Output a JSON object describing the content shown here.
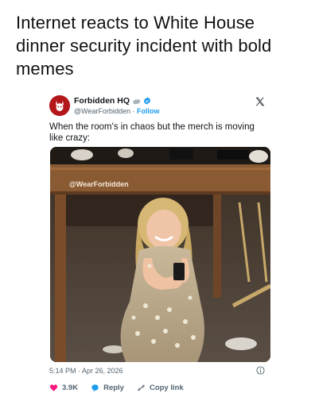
{
  "headline": "Internet reacts to White House dinner security incident with bold memes",
  "tweet": {
    "display_name": "Forbidden HQ",
    "handle": "@WearForbidden",
    "separator": " · ",
    "follow_label": "Follow",
    "text": "When the room's in chaos but the merch is moving like crazy:",
    "watermark": "@WearForbidden",
    "timestamp": "5:14 PM · Apr 26, 2026",
    "likes": "3.9K",
    "reply_label": "Reply",
    "copy_link_label": "Copy link"
  },
  "colors": {
    "brand": "#b3171a",
    "link": "#1d9bf0",
    "like": "#f91880",
    "muted": "#536471"
  },
  "icons": [
    "x-logo-icon",
    "verified-badge-icon",
    "info-icon",
    "heart-icon",
    "reply-bubble-icon",
    "link-icon"
  ]
}
